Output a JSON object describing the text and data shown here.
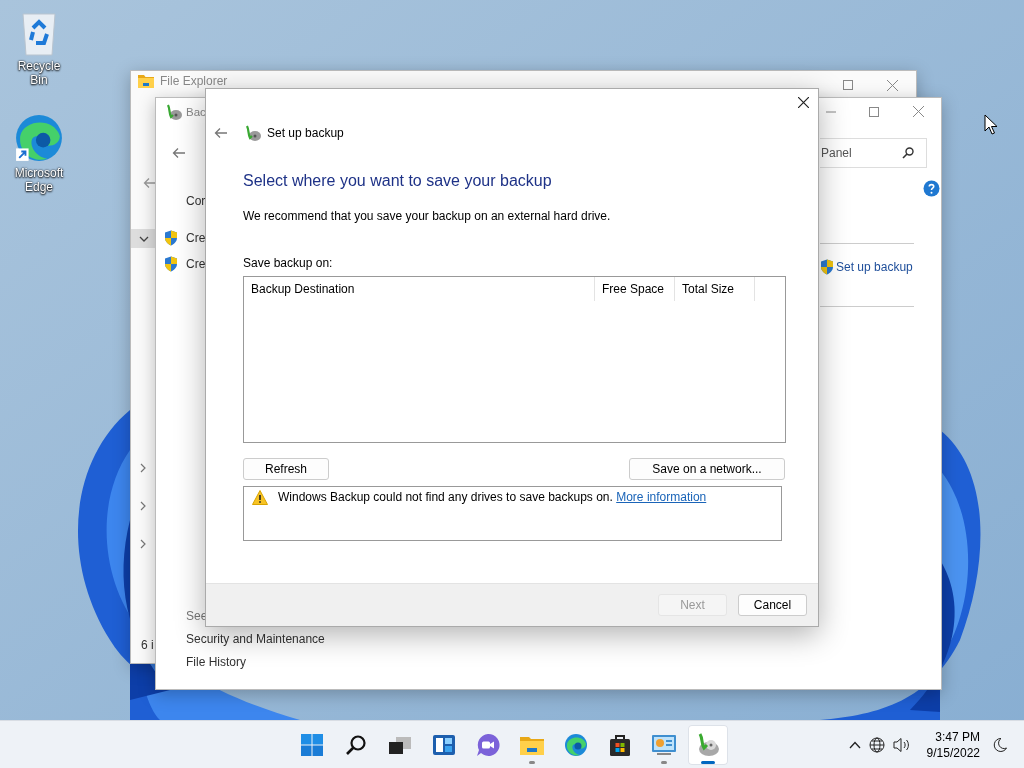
{
  "desktop_icons": [
    {
      "label": "Recycle Bin",
      "kind": "recycle"
    },
    {
      "label": "Microsoft Edge",
      "kind": "edge"
    }
  ],
  "file_explorer": {
    "title": "File Explorer",
    "status": "6 i"
  },
  "control_panel": {
    "title": "Bac",
    "left_items": [
      {
        "text": "Cor",
        "kind": "text"
      },
      {
        "text": "Cre",
        "kind": "shield"
      },
      {
        "text": "Cre",
        "kind": "shield"
      }
    ],
    "see_also": {
      "heading": "See",
      "links": [
        "Security and Maintenance",
        "File History"
      ]
    },
    "search": {
      "placeholder": "Panel"
    },
    "task_link": "Set up backup"
  },
  "dialog": {
    "title": "Set up backup",
    "heading": "Select where you want to save your backup",
    "description": "We recommend that you save your backup on an external hard drive.",
    "list_label": "Save backup on:",
    "columns": [
      "Backup Destination",
      "Free Space",
      "Total Size"
    ],
    "refresh_button": "Refresh",
    "network_button": "Save on a network...",
    "message": {
      "text": "Windows Backup could not find any drives to save backups on.",
      "link": "More information"
    },
    "footer_buttons": [
      {
        "label": "Next",
        "disabled": true
      },
      {
        "label": "Cancel",
        "disabled": false
      }
    ]
  },
  "taskbar": {
    "apps": [
      {
        "kind": "start",
        "running": false,
        "selected": false
      },
      {
        "kind": "search",
        "running": false,
        "selected": false
      },
      {
        "kind": "taskview",
        "running": false,
        "selected": false
      },
      {
        "kind": "widgets",
        "running": false,
        "selected": false
      },
      {
        "kind": "chat",
        "running": false,
        "selected": false
      },
      {
        "kind": "explorer",
        "running": true,
        "selected": false
      },
      {
        "kind": "edge",
        "running": false,
        "selected": false
      },
      {
        "kind": "store",
        "running": false,
        "selected": false
      },
      {
        "kind": "controlpanel",
        "running": true,
        "selected": false
      },
      {
        "kind": "backup",
        "running": true,
        "selected": true
      }
    ],
    "time": "3:47 PM",
    "date": "9/15/2022"
  }
}
